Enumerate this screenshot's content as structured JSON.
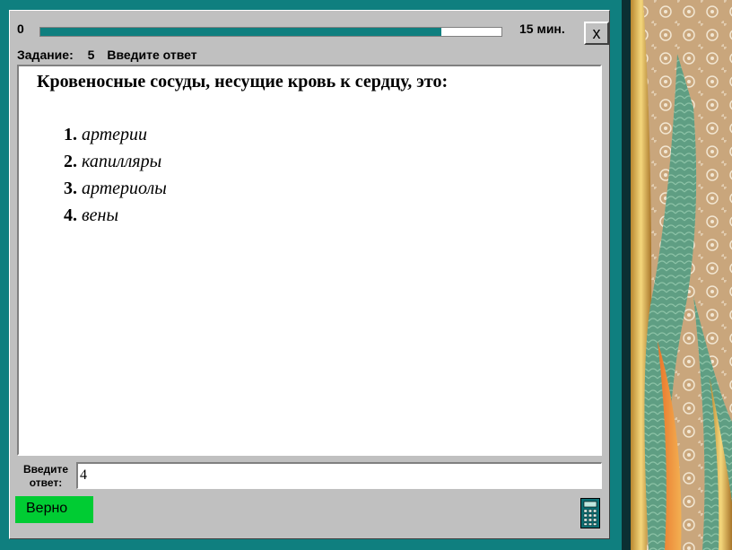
{
  "topbar": {
    "start_label": "0",
    "progress_fraction": 0.87,
    "time_label": "15 мин.",
    "close_label": "x"
  },
  "task": {
    "label": "Задание:",
    "number": "5",
    "instruction": "Введите ответ"
  },
  "question": {
    "text": "Кровеносные сосуды, несущие кровь к сердцу, это:",
    "options": [
      {
        "num": "1.",
        "text": "артерии"
      },
      {
        "num": "2.",
        "text": "капилляры"
      },
      {
        "num": "3.",
        "text": "артериолы"
      },
      {
        "num": "4.",
        "text": "вены"
      }
    ]
  },
  "answer": {
    "label_line1": "Введите",
    "label_line2": "ответ:",
    "value": "4"
  },
  "result": {
    "label": "Верно"
  },
  "icons": {
    "calculator": "calculator-icon"
  },
  "colors": {
    "frame": "#0f7f7f",
    "progress_fill": "#0f7f7f",
    "result_bg": "#00cc33"
  }
}
